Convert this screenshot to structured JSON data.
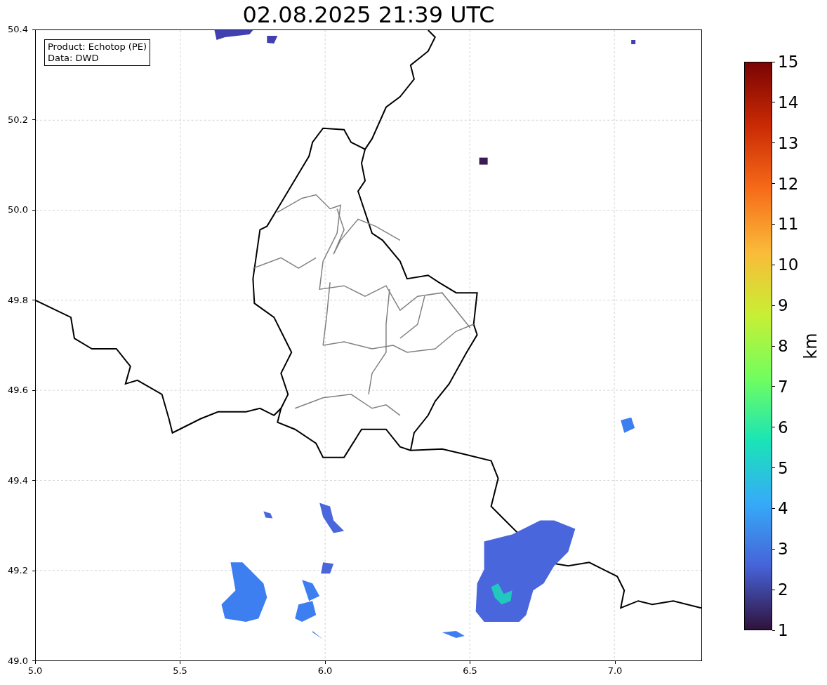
{
  "title": "02.08.2025 21:39 UTC",
  "legend": [
    "Product: Echotop (PE)",
    "Data: DWD"
  ],
  "x_ticks": [
    "5.0",
    "5.5",
    "6.0",
    "6.5",
    "7.0"
  ],
  "y_ticks": [
    "50.4",
    "50.2",
    "50.0",
    "49.8",
    "49.6",
    "49.4",
    "49.2",
    "49.0"
  ],
  "colorbar": {
    "label": "km",
    "ticks": [
      "15",
      "14",
      "13",
      "12",
      "11",
      "10",
      "9",
      "8",
      "7",
      "6",
      "5",
      "4",
      "3",
      "2",
      "1"
    ]
  }
}
